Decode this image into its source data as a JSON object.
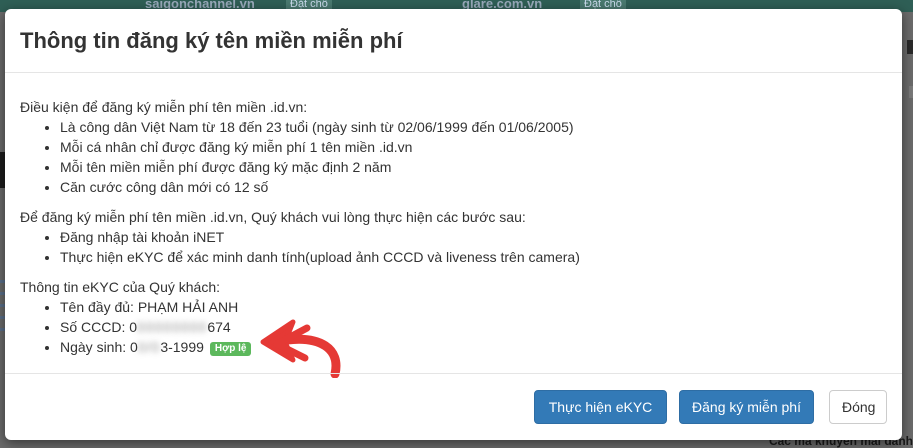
{
  "background": {
    "site_left": "saigonchannel.vn",
    "site_left_tag": "Đặt chỗ",
    "site_right": "glare.com.vn",
    "site_right_tag": "Đặt chỗ",
    "bottom_text": "Các mã khuyến mãi dành"
  },
  "modal": {
    "title": "Thông tin đăng ký tên miền miễn phí",
    "conditions": {
      "intro": "Điều kiện để đăng ký miễn phí tên miền .id.vn:",
      "items": [
        "Là công dân Việt Nam từ 18 đến 23 tuổi (ngày sinh từ 02/06/1999 đến 01/06/2005)",
        "Mỗi cá nhân chỉ được đăng ký miễn phí 1 tên miền .id.vn",
        "Mỗi tên miền miễn phí được đăng ký mặc định 2 năm",
        "Căn cước công dân mới có 12 số"
      ]
    },
    "steps": {
      "intro": "Để đăng ký miễn phí tên miền .id.vn, Quý khách vui lòng thực hiện các bước sau:",
      "items": [
        "Đăng nhập tài khoản iNET",
        "Thực hiện eKYC để xác minh danh tính(upload ảnh CCCD và liveness trên camera)"
      ]
    },
    "ekyc": {
      "intro": "Thông tin eKYC của Quý khách:",
      "full_name_label": "Tên đầy đủ:",
      "full_name": "PHẠM HẢI ANH",
      "id_label": "Số CCCD:",
      "id_masked": "0",
      "id_end": "674",
      "dob_label": "Ngày sinh:",
      "dob_masked": "0",
      "dob_end": "3-1999",
      "valid_badge": "Hợp lệ"
    },
    "annotation_color": "#e53935",
    "buttons": {
      "ekyc": "Thực hiện eKYC",
      "register": "Đăng ký miễn phí",
      "close": "Đóng"
    },
    "colors": {
      "primary": "#337ab7",
      "badge": "#5cb85c"
    }
  }
}
